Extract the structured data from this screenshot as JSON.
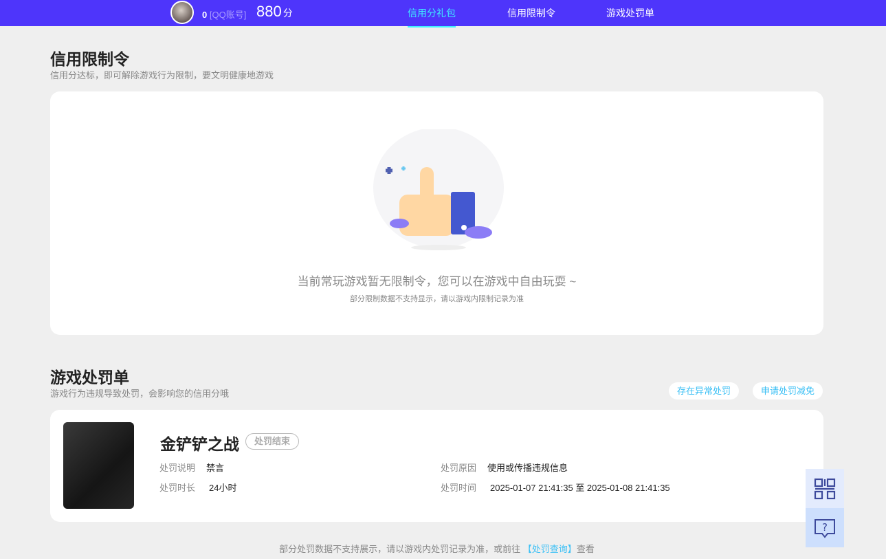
{
  "header": {
    "account_id": "0",
    "account_type": "[QQ账号]",
    "score": "880",
    "score_unit": "分",
    "tabs": [
      {
        "label": "信用分礼包",
        "active": true
      },
      {
        "label": "信用限制令"
      },
      {
        "label": "游戏处罚单"
      }
    ]
  },
  "restriction": {
    "title": "信用限制令",
    "subtitle": "信用分达标，即可解除游戏行为限制，要文明健康地游戏",
    "empty_main": "当前常玩游戏暂无限制令，您可以在游戏中自由玩耍 ~",
    "empty_sub": "部分限制数据不支持显示，请以游戏内限制记录为准"
  },
  "penalty": {
    "title": "游戏处罚单",
    "subtitle": "游戏行为违规导致处罚，会影响您的信用分哦",
    "buttons": [
      "存在异常处罚",
      "申请处罚减免"
    ],
    "item": {
      "game": "金铲铲之战",
      "status": "处罚结束",
      "desc_label": "处罚说明",
      "desc": "禁言",
      "reason_label": "处罚原因",
      "reason": "使用或传播违规信息",
      "duration_label": "处罚时长",
      "duration": "24小时",
      "time_label": "处罚时间",
      "time": "2025-01-07 21:41:35 至 2025-01-08 21:41:35"
    },
    "footer_pre": "部分处罚数据不支持展示，请以游戏内处罚记录为准，或前往 ",
    "footer_link": "【处罚查询】",
    "footer_post": "查看"
  }
}
